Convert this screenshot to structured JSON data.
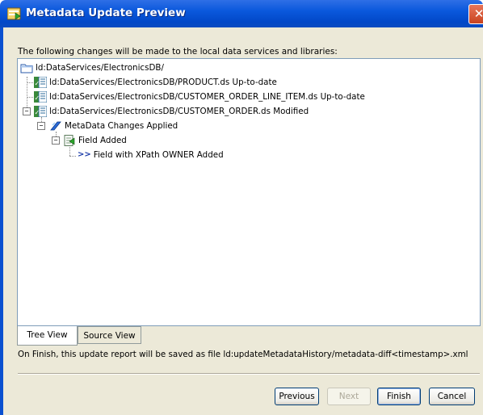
{
  "window": {
    "title": "Metadata Update Preview",
    "close_glyph": "✕"
  },
  "intro_text": "The following changes will be made to the local data services and libraries:",
  "tree": {
    "root": {
      "label": "ld:DataServices/ElectronicsDB/",
      "icon": "folder-icon"
    },
    "product": {
      "label": "ld:DataServices/ElectronicsDB/PRODUCT.ds Up-to-date",
      "icon": "data-service-icon"
    },
    "line_item": {
      "label": "ld:DataServices/ElectronicsDB/CUSTOMER_ORDER_LINE_ITEM.ds Up-to-date",
      "icon": "data-service-icon"
    },
    "customer_order": {
      "label": "ld:DataServices/ElectronicsDB/CUSTOMER_ORDER.ds Modified",
      "icon": "data-service-icon",
      "expander": "−"
    },
    "metadata_changes": {
      "label": "MetaData Changes Applied",
      "icon": "metadata-changes-icon",
      "expander": "−"
    },
    "field_added": {
      "label": "Field  Added",
      "icon": "field-icon",
      "expander": "−"
    },
    "xpath_field": {
      "label": "Field with XPath  OWNER Added",
      "icon_text": ">>"
    }
  },
  "tabs": [
    {
      "label": "Tree View",
      "active": true
    },
    {
      "label": "Source View",
      "active": false
    }
  ],
  "report_text": "On Finish, this update report will be saved as file ld:updateMetadataHistory/metadata-diff<timestamp>.xml",
  "buttons": {
    "previous": "Previous",
    "next": "Next",
    "finish": "Finish",
    "cancel": "Cancel"
  },
  "colors": {
    "titlebar": "#0a58dc",
    "dialog_bg": "#ece9d8",
    "tree_border": "#7f9db9",
    "xpath_arrow": "#1a3aa8"
  }
}
